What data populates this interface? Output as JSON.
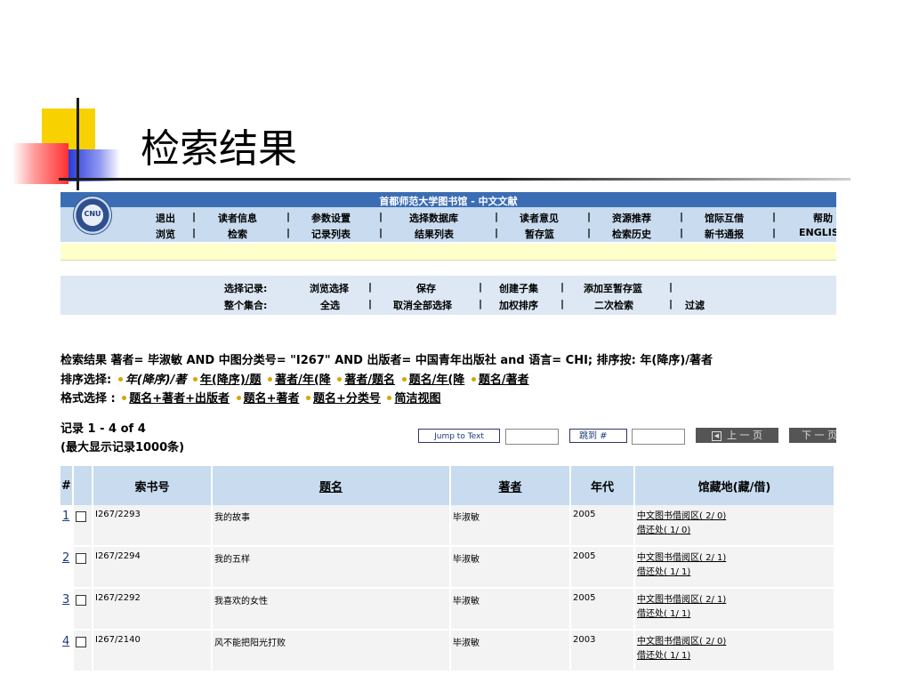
{
  "slide": {
    "title": "检索结果"
  },
  "header": {
    "site_title": "首都师范大学图书馆 - 中文文献",
    "logo_text": "CNU",
    "menu_row1": [
      "退出",
      "读者信息",
      "参数设置",
      "选择数据库",
      "读者意见",
      "资源推荐",
      "馆际互借",
      "帮助"
    ],
    "menu_row2": [
      "浏览",
      "检索",
      "记录列表",
      "结果列表",
      "暂存篮",
      "检索历史",
      "新书通报",
      "ENGLISH"
    ]
  },
  "actions": {
    "row1_label": "选择记录:",
    "row1": [
      "浏览选择",
      "保存",
      "创建子集",
      "添加至暂存篮"
    ],
    "row2_label": "整个集合:",
    "row2": [
      "全选",
      "取消全部选择",
      "加权排序",
      "二次检索",
      "过滤"
    ]
  },
  "query": {
    "line1": "检索结果 著者= 毕淑敏 AND 中图分类号= \"I267\" AND 出版者= 中国青年出版社 and 语言= CHI; 排序按: 年(降序)/著者",
    "sort_label": "排序选择:",
    "sort_options": [
      "年(降序)/著",
      "年(降序)/题",
      "著者/年(降",
      "著者/题名",
      "题名/年(降",
      "题名/著者"
    ],
    "format_label": "格式选择 :",
    "format_options": [
      "题名+著者+出版者",
      "题名+著者",
      "题名+分类号",
      "简洁视图"
    ]
  },
  "records": {
    "range": "记录 1 - 4 of 4",
    "max_note": "(最大显示记录1000条)",
    "jump_text_button": "Jump to Text",
    "goto_button": "跳到 #",
    "prev_button": "上 一 页",
    "next_button": "下 一 页"
  },
  "table": {
    "headers": [
      "#",
      "",
      "索书号",
      "题名",
      "著者",
      "年代",
      "馆藏地(藏/借)"
    ],
    "rows": [
      {
        "num": "1",
        "call": "I267/2293",
        "title": "我的故事",
        "author": "毕淑敏",
        "year": "2005",
        "hold1": "中文图书借阅区( 2/ 0)",
        "hold2": "借还处( 1/ 0)"
      },
      {
        "num": "2",
        "call": "I267/2294",
        "title": "我的五样",
        "author": "毕淑敏",
        "year": "2005",
        "hold1": "中文图书借阅区( 2/ 1)",
        "hold2": "借还处( 1/ 1)"
      },
      {
        "num": "3",
        "call": "I267/2292",
        "title": "我喜欢的女性",
        "author": "毕淑敏",
        "year": "2005",
        "hold1": "中文图书借阅区( 2/ 1)",
        "hold2": "借还处( 1/ 1)"
      },
      {
        "num": "4",
        "call": "I267/2140",
        "title": "风不能把阳光打败",
        "author": "毕淑敏",
        "year": "2003",
        "hold1": "中文图书借阅区( 2/ 0)",
        "hold2": "借还处( 1/ 1)"
      }
    ]
  }
}
